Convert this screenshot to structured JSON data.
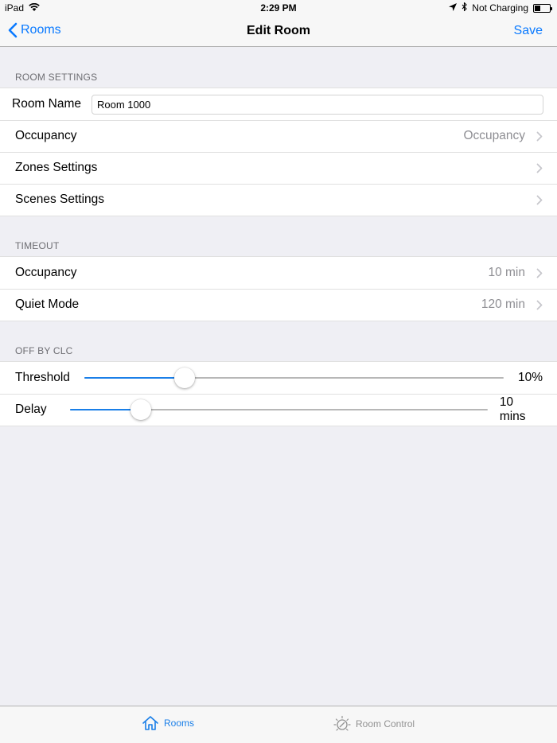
{
  "status": {
    "device": "iPad",
    "time": "2:29 PM",
    "charging": "Not Charging",
    "battery_level": 0.4
  },
  "nav": {
    "back_label": "Rooms",
    "title": "Edit Room",
    "save_label": "Save"
  },
  "room_settings": {
    "header": "ROOM SETTINGS",
    "room_name_label": "Room Name",
    "room_name_value": "Room 1000",
    "occupancy_label": "Occupancy",
    "occupancy_value": "Occupancy",
    "zones_label": "Zones Settings",
    "scenes_label": "Scenes Settings"
  },
  "timeout": {
    "header": "TIMEOUT",
    "occupancy_label": "Occupancy",
    "occupancy_value": "10 min",
    "quiet_label": "Quiet Mode",
    "quiet_value": "120 min"
  },
  "off_by_clc": {
    "header": "OFF BY CLC",
    "threshold_label": "Threshold",
    "threshold_value": "10%",
    "threshold_fraction": 0.24,
    "delay_label": "Delay",
    "delay_value": "10 mins",
    "delay_fraction": 0.17
  },
  "tabs": [
    {
      "label": "Rooms",
      "icon": "house-icon",
      "active": true
    },
    {
      "label": "Room Control",
      "icon": "lightbulb-icon",
      "active": false
    }
  ],
  "colors": {
    "accent": "#0a7aff",
    "slider_fill": "#1a7fe8"
  }
}
